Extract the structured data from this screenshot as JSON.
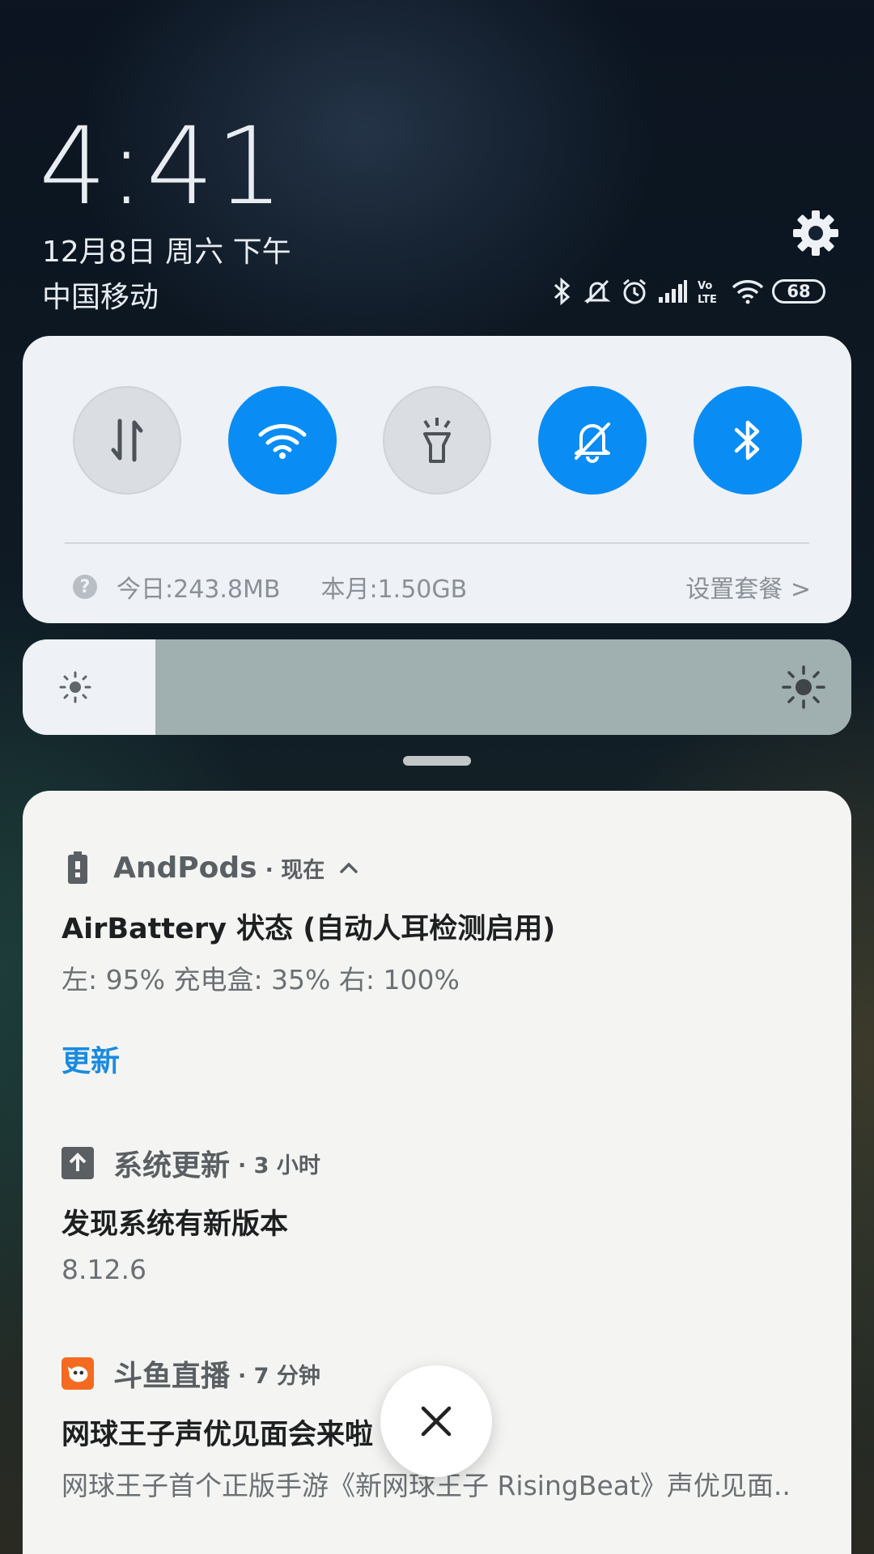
{
  "header": {
    "time": "4:41",
    "date": "12月8日 周六 下午",
    "carrier": "中国移动",
    "battery_level": "68",
    "status_icons": [
      "bluetooth-icon",
      "mute-icon",
      "alarm-icon",
      "signal-icon",
      "volte-icon",
      "wifi-icon",
      "battery-icon"
    ],
    "volte_label": "VoLTE"
  },
  "quick_settings": {
    "tiles": [
      {
        "name": "mobile-data",
        "icon": "data-arrows-icon",
        "active": false
      },
      {
        "name": "wifi",
        "icon": "wifi-icon",
        "active": true
      },
      {
        "name": "flashlight",
        "icon": "flashlight-icon",
        "active": false
      },
      {
        "name": "silent",
        "icon": "bell-off-icon",
        "active": true
      },
      {
        "name": "bluetooth",
        "icon": "bluetooth-icon",
        "active": true
      }
    ],
    "data_today": "今日:243.8MB",
    "data_month": "本月:1.50GB",
    "plan_link": "设置套餐 >",
    "help_glyph": "?",
    "accent_color": "#0a8cf5"
  },
  "brightness": {
    "level_fraction": 0.16
  },
  "notifications": [
    {
      "app": "AndPods",
      "meta": "· 现在",
      "expand_icon": "chevron-up-icon",
      "title": "AirBattery 状态 (自动人耳检测启用)",
      "text": "左: 95%   充电盒: 35% 右: 100%",
      "action": "更新"
    },
    {
      "app": "系统更新",
      "meta": "· 3 小时",
      "title": "发现系统有新版本",
      "text": "8.12.6"
    },
    {
      "app": "斗鱼直播",
      "meta": "· 7 分钟",
      "title": "网球王子声优见面会来啦",
      "text": "网球王子首个正版手游《新网球王子 RisingBeat》声优见面.."
    }
  ],
  "dismiss_all": {
    "icon": "close-icon"
  }
}
